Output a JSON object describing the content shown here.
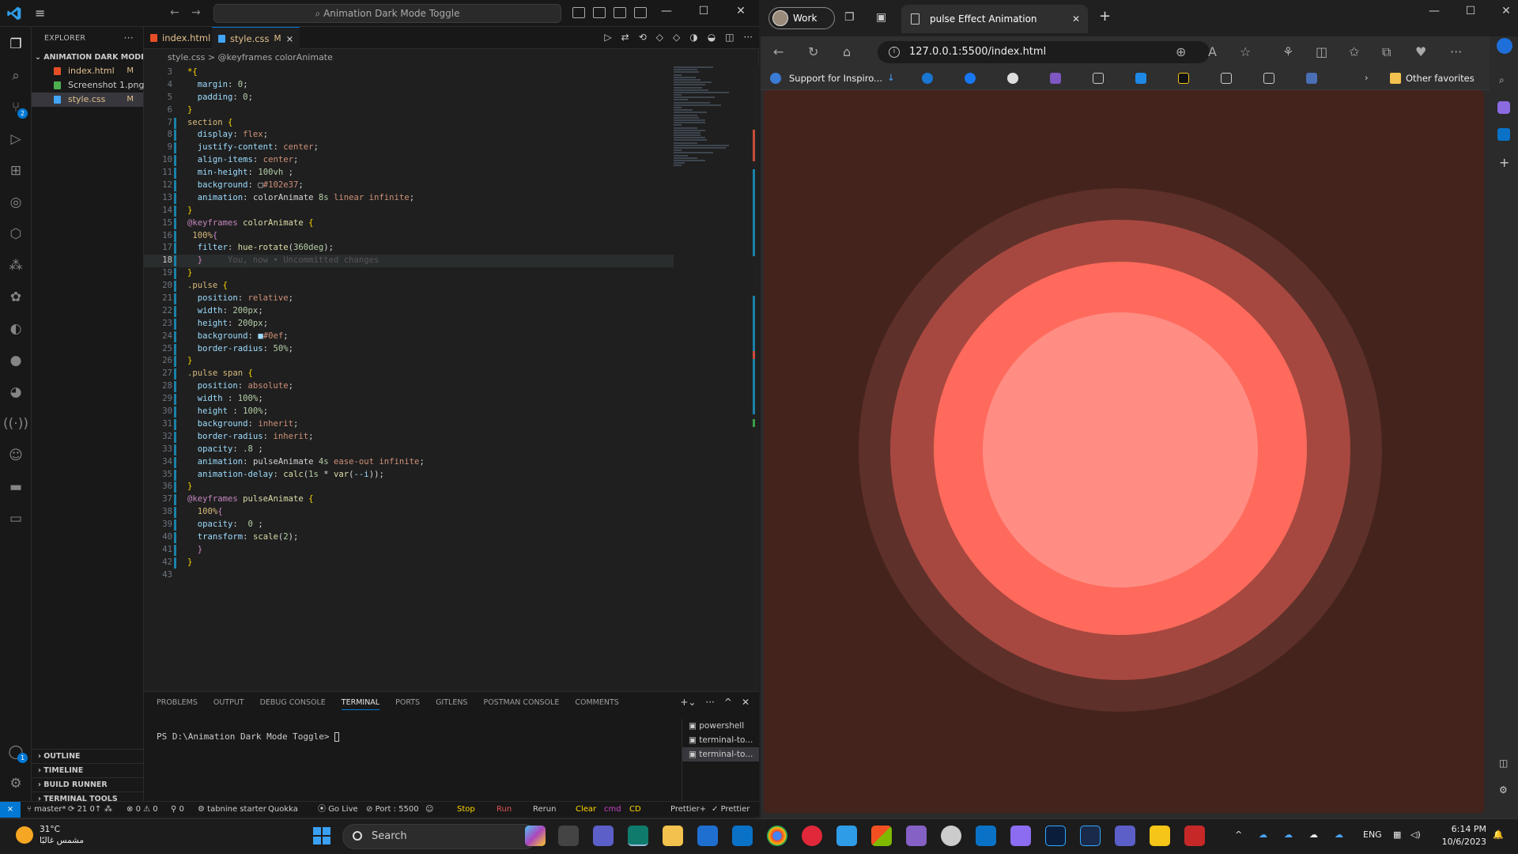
{
  "vscode": {
    "search_text": "Animation Dark Mode Toggle",
    "explorer": {
      "title": "EXPLORER",
      "folder": "ANIMATION DARK MODE ...",
      "files": [
        {
          "name": "index.html",
          "mark": "M",
          "color": "#e44d26"
        },
        {
          "name": "Screenshot 1.png",
          "mark": "",
          "color": "#4caf50"
        },
        {
          "name": "style.css",
          "mark": "M",
          "color": "#42a5f5"
        }
      ],
      "sections": [
        "OUTLINE",
        "TIMELINE",
        "BUILD RUNNER",
        "TERMINAL TOOLS"
      ],
      "account_badge": "1"
    },
    "tabs": [
      {
        "label": "index.html",
        "mark": "M",
        "color": "#e44d26"
      },
      {
        "label": "style.css",
        "mark": "M",
        "close": "×",
        "color": "#42a5f5"
      }
    ],
    "breadcrumb": {
      "file": "style.css",
      "sep": ">",
      "symbol": "@keyframes colorAnimate"
    },
    "scm_badge": "2",
    "code_start_line": 3,
    "current_line": 18,
    "panel": {
      "tabs": [
        "PROBLEMS",
        "OUTPUT",
        "DEBUG CONSOLE",
        "TERMINAL",
        "PORTS",
        "GITLENS",
        "POSTMAN CONSOLE",
        "COMMENTS"
      ],
      "active_tab": "TERMINAL",
      "prompt": "PS D:\\Animation Dark Mode Toggle>",
      "terminals": [
        "powershell",
        "terminal-to...",
        "terminal-to..."
      ]
    },
    "status": {
      "branch": "master*",
      "sync": "21 0↑",
      "errors": "0",
      "warnings": "0",
      "ports": "0",
      "tabnine": "tabnine starter",
      "quokka": "Quokka",
      "golive": "Go Live",
      "port": "Port : 5500",
      "stop": "Stop",
      "run": "Run",
      "rerun": "Rerun",
      "clear": "Clear",
      "cmd": "cmd",
      "cd": "CD",
      "prettier_plus": "Prettier+",
      "prettier": "Prettier"
    }
  },
  "edge": {
    "profile": "Work",
    "tab_title": "pulse Effect Animation",
    "url": "127.0.0.1:5500/index.html",
    "favorites": {
      "first": "Support for Inspiro...",
      "other": "Other favorites"
    },
    "colors": {
      "bg": "#45231d",
      "ring1": "#5e302a",
      "ring2": "#a74840",
      "ring3": "#ff6a5c",
      "core": "#ff8d84"
    }
  },
  "taskbar": {
    "weather_temp": "31°C",
    "weather_desc": "مشمس غالبًا",
    "search_placeholder": "Search",
    "lang": "ENG",
    "time": "6:14 PM",
    "date": "10/6/2023"
  }
}
